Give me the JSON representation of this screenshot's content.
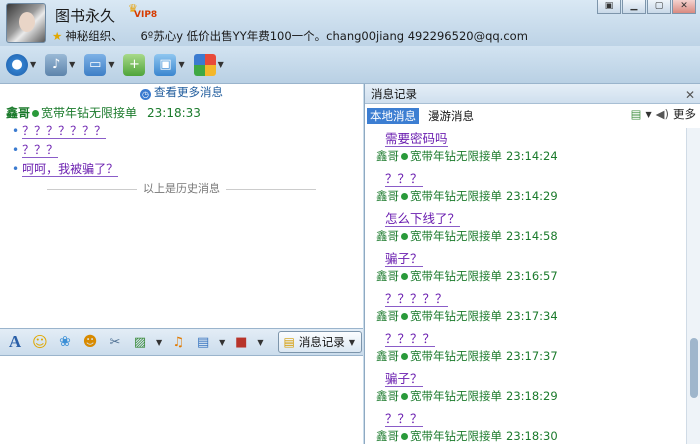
{
  "window": {
    "buddy_name": "图书永久",
    "vip_badge": "VIP8",
    "group_label": "神秘组织、",
    "signature": "6º苏心y  低价出售YY年费100一个。chang00jiang  492296520@qq.com"
  },
  "window_buttons": [
    "▣",
    "▁",
    "▢",
    "✕"
  ],
  "toolbar": {
    "icons": [
      "camera-icon",
      "microphone-icon",
      "folder-icon",
      "message-add-icon",
      "screen-share-icon",
      "apps-icon"
    ]
  },
  "left_panel": {
    "more_messages": "查看更多消息",
    "sender": "鑫哥",
    "sender_tag": "宽带年钻无限接单",
    "time": "23:18:33",
    "messages": [
      "？？？？？？？",
      "？？？",
      "呵呵，我被骗了？"
    ],
    "history_divider": "以上是历史消息",
    "format_tools": [
      "font-icon",
      "emoji-icon",
      "gift-icon",
      "shake-icon",
      "screenshot-icon",
      "image-icon",
      "music-icon",
      "screen-icon",
      "record-icon"
    ],
    "msg_log_button": "消息记录"
  },
  "right_panel": {
    "title": "消息记录",
    "close": "✕",
    "tabs": [
      {
        "label": "本地消息",
        "active": true
      },
      {
        "label": "漫游消息",
        "active": false
      }
    ],
    "more": "更多",
    "log": [
      {
        "kind": "msg",
        "text": "需要密码吗"
      },
      {
        "kind": "header",
        "sender": "鑫哥",
        "tag": "宽带年钻无限接单",
        "time": "23:14:24"
      },
      {
        "kind": "msg",
        "text": "？？？"
      },
      {
        "kind": "header",
        "sender": "鑫哥",
        "tag": "宽带年钻无限接单",
        "time": "23:14:29"
      },
      {
        "kind": "msg",
        "text": "怎么下线了？"
      },
      {
        "kind": "header",
        "sender": "鑫哥",
        "tag": "宽带年钻无限接单",
        "time": "23:14:58"
      },
      {
        "kind": "msg",
        "text": "骗子？"
      },
      {
        "kind": "header",
        "sender": "鑫哥",
        "tag": "宽带年钻无限接单",
        "time": "23:16:57"
      },
      {
        "kind": "msg",
        "text": "？？？？？"
      },
      {
        "kind": "header",
        "sender": "鑫哥",
        "tag": "宽带年钻无限接单",
        "time": "23:17:34"
      },
      {
        "kind": "msg",
        "text": "？？？？"
      },
      {
        "kind": "header",
        "sender": "鑫哥",
        "tag": "宽带年钻无限接单",
        "time": "23:17:37"
      },
      {
        "kind": "msg",
        "text": "骗子？"
      },
      {
        "kind": "header",
        "sender": "鑫哥",
        "tag": "宽带年钻无限接单",
        "time": "23:18:29"
      },
      {
        "kind": "msg",
        "text": "？？？"
      },
      {
        "kind": "header",
        "sender": "鑫哥",
        "tag": "宽带年钻无限接单",
        "time": "23:18:30"
      }
    ]
  }
}
